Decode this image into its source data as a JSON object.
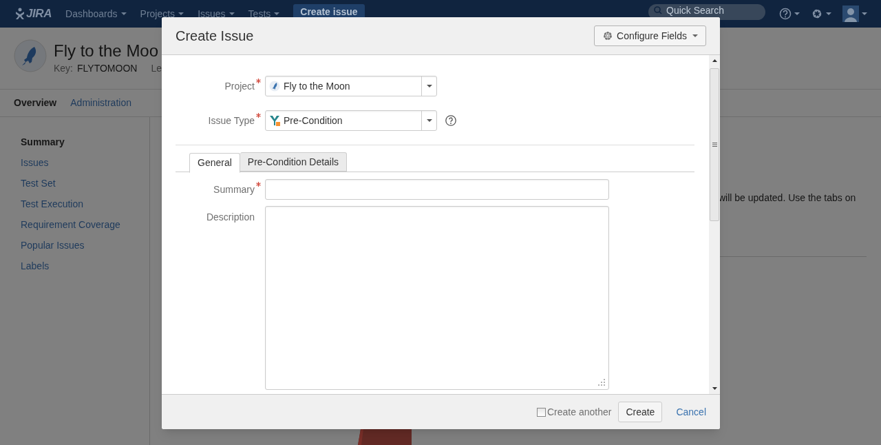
{
  "header": {
    "logo": "JIRA",
    "nav": [
      {
        "label": "Dashboards"
      },
      {
        "label": "Projects"
      },
      {
        "label": "Issues"
      },
      {
        "label": "Tests"
      }
    ],
    "create_button": "Create issue",
    "search": {
      "placeholder": "Quick Search"
    }
  },
  "project": {
    "name": "Fly to the Moo",
    "key_label": "Key:",
    "key": "FLYTOMOON",
    "lead": "Le"
  },
  "project_tabs": [
    {
      "label": "Overview",
      "selected": true
    },
    {
      "label": "Administration",
      "selected": false
    }
  ],
  "sidebar": {
    "items": [
      {
        "label": "Summary",
        "selected": true
      },
      {
        "label": "Issues",
        "selected": false
      },
      {
        "label": "Test Set",
        "selected": false
      },
      {
        "label": "Test Execution",
        "selected": false
      },
      {
        "label": "Requirement Coverage",
        "selected": false
      },
      {
        "label": "Popular Issues",
        "selected": false
      },
      {
        "label": "Labels",
        "selected": false
      }
    ]
  },
  "main": {
    "text": "will be updated. Use the tabs on"
  },
  "dialog": {
    "title": "Create Issue",
    "configure_button": "Configure Fields",
    "top_fields": [
      {
        "kind": "select",
        "label": "Project",
        "required": true,
        "value": "Fly to the Moon",
        "help": false
      },
      {
        "kind": "select",
        "label": "Issue Type",
        "required": true,
        "value": "Pre-Condition",
        "help": true
      }
    ],
    "tabs": [
      {
        "label": "General",
        "selected": true
      },
      {
        "label": "Pre-Condition Details",
        "selected": false
      }
    ],
    "fields": [
      {
        "kind": "text",
        "label": "Summary",
        "required": true
      },
      {
        "kind": "textarea",
        "label": "Description",
        "required": false
      }
    ],
    "footer": {
      "create_another": {
        "label": "Create another",
        "checked": false
      },
      "create_button": "Create",
      "cancel_link": "Cancel"
    }
  }
}
